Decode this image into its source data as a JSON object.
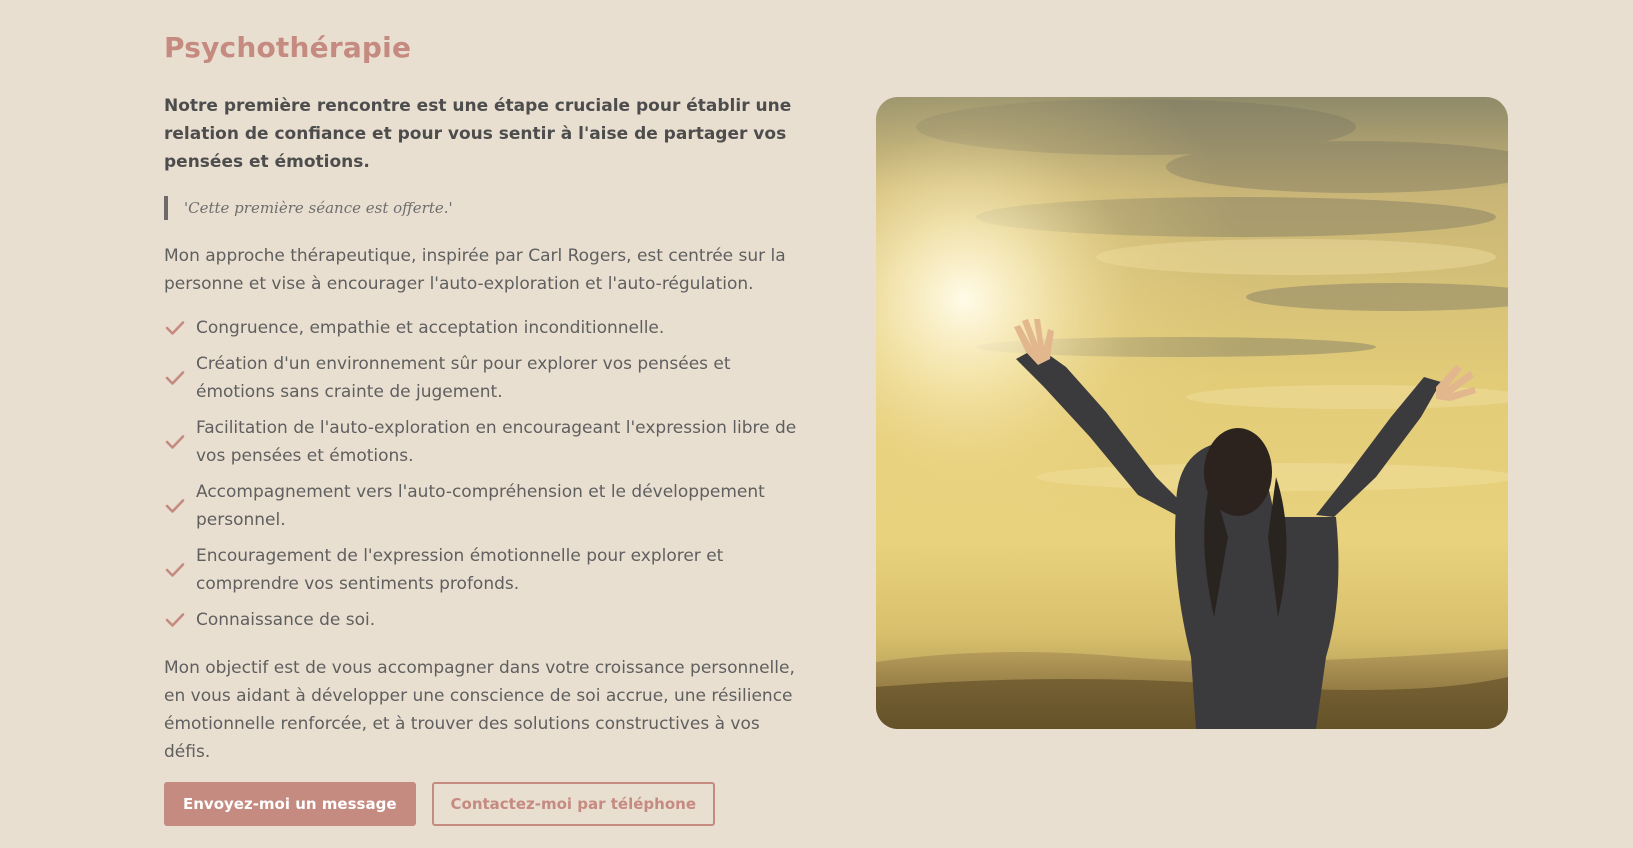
{
  "section": {
    "title": "Psychothérapie",
    "lead": "Notre première rencontre est une étape cruciale pour établir une relation de confiance et pour vous sentir à l'aise de partager vos pensées et émotions.",
    "quote": "'Cette première séance est offerte.'",
    "approach": "Mon approche thérapeutique, inspirée par Carl Rogers, est centrée sur la personne et vise à encourager l'auto-exploration et l'auto-régulation.",
    "checklist": [
      "Congruence, empathie et acceptation inconditionnelle.",
      "Création d'un environnement sûr pour explorer vos pensées et émotions sans crainte de jugement.",
      "Facilitation de l'auto-exploration en encourageant l'expression libre de vos pensées et émotions.",
      "Accompagnement vers l'auto-compréhension et le développement personnel.",
      "Encouragement de l'expression émotionnelle pour explorer et comprendre vos sentiments profonds.",
      "Connaissance de soi."
    ],
    "objective": "Mon objectif est de vous accompagner dans votre croissance personnelle, en vous aidant à développer une conscience de soi accrue, une résilience émotionnelle renforcée, et à trouver des solutions constructives à vos défis.",
    "buttons": {
      "message": "Envoyez-moi un message",
      "phone": "Contactez-moi par téléphone"
    }
  },
  "image": {
    "subject": "woman-raising-arms-at-sunset"
  },
  "colors": {
    "background": "#e9dfd1",
    "accent": "#c58a80",
    "text": "#5f5f5f"
  },
  "icons": {
    "check": "check-icon"
  }
}
